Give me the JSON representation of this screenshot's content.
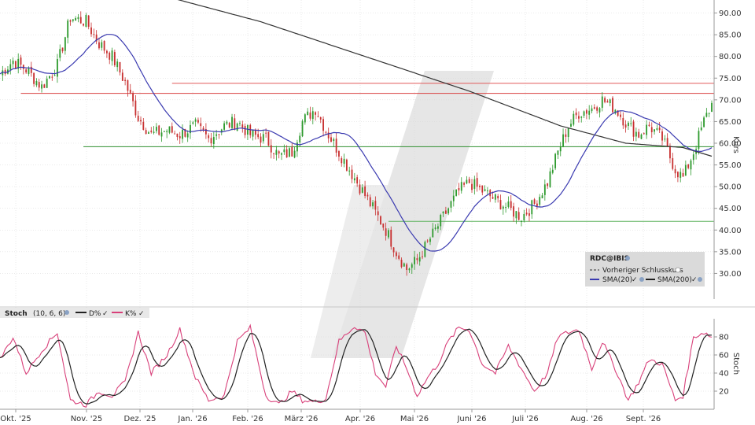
{
  "chart_data": {
    "type": "candlestick",
    "price_axis": {
      "label": "Kurs",
      "ticks": [
        "90.00",
        "85.00",
        "80.00",
        "75.00",
        "70.00",
        "65.00",
        "60.00",
        "55.00",
        "50.00",
        "45.00",
        "40.00",
        "35.00",
        "30.00"
      ],
      "ylim": [
        25,
        93
      ]
    },
    "months": [
      "Okt. '25",
      "Nov. '25",
      "Dez. '25",
      "Jan. '26",
      "Feb. '26",
      "März '26",
      "Apr. '26",
      "Mai '26",
      "Juni '26",
      "Juli '26",
      "Aug. '26",
      "Sept. '26"
    ],
    "num_bars": 250,
    "close_path": [
      [
        0,
        76
      ],
      [
        5,
        79
      ],
      [
        10,
        77
      ],
      [
        16,
        73
      ],
      [
        22,
        78
      ],
      [
        27,
        89
      ],
      [
        33,
        88
      ],
      [
        38,
        83
      ],
      [
        43,
        80
      ],
      [
        48,
        74
      ],
      [
        53,
        66
      ],
      [
        58,
        62
      ],
      [
        64,
        63
      ],
      [
        69,
        62
      ],
      [
        75,
        64
      ],
      [
        80,
        61
      ],
      [
        86,
        64
      ],
      [
        91,
        65
      ],
      [
        96,
        62
      ],
      [
        102,
        61
      ],
      [
        107,
        57
      ],
      [
        112,
        58
      ],
      [
        116,
        65
      ],
      [
        121,
        68
      ],
      [
        125,
        63
      ],
      [
        130,
        58
      ],
      [
        136,
        52
      ],
      [
        140,
        48
      ],
      [
        144,
        44
      ],
      [
        148,
        40
      ],
      [
        152,
        35
      ],
      [
        156,
        31
      ],
      [
        160,
        33
      ],
      [
        164,
        37
      ],
      [
        168,
        41
      ],
      [
        172,
        45
      ],
      [
        176,
        49
      ],
      [
        180,
        51
      ],
      [
        185,
        49
      ],
      [
        190,
        47
      ],
      [
        195,
        45
      ],
      [
        200,
        43
      ],
      [
        205,
        46
      ],
      [
        210,
        51
      ],
      [
        214,
        58
      ],
      [
        218,
        64
      ],
      [
        222,
        67
      ],
      [
        227,
        68
      ],
      [
        231,
        70
      ],
      [
        236,
        68
      ],
      [
        241,
        64
      ],
      [
        245,
        62
      ],
      [
        249,
        64
      ],
      [
        254,
        61
      ],
      [
        259,
        54
      ],
      [
        262,
        52
      ],
      [
        266,
        58
      ],
      [
        270,
        65
      ],
      [
        273,
        69
      ]
    ],
    "horizontal_levels": [
      {
        "value": 73.8,
        "color": "#e05a5a",
        "from_bar": 66
      },
      {
        "value": 71.5,
        "color": "#d84040",
        "from_bar": 8
      },
      {
        "value": 59.2,
        "color": "#2f8f2f",
        "from_bar": 32
      },
      {
        "value": 42.0,
        "color": "#5fb25f",
        "from_bar": 149
      }
    ],
    "legend": {
      "symbol": "RDC@IBIS",
      "prev_close": "Vorheriger Schlusskurs",
      "sma20": "SMA(20)",
      "sma200": "SMA(200)"
    },
    "stoch": {
      "title": "Stoch",
      "params": "(10, 6, 6)",
      "d_label": "D%",
      "k_label": "K%",
      "axis_label": "Stoch",
      "ticks": [
        "80",
        "60",
        "40",
        "20"
      ],
      "ylim": [
        0,
        100
      ],
      "k_anchors": [
        [
          0,
          55
        ],
        [
          5,
          80
        ],
        [
          10,
          40
        ],
        [
          16,
          65
        ],
        [
          22,
          85
        ],
        [
          27,
          10
        ],
        [
          33,
          5
        ],
        [
          38,
          20
        ],
        [
          43,
          15
        ],
        [
          48,
          30
        ],
        [
          53,
          85
        ],
        [
          58,
          40
        ],
        [
          64,
          60
        ],
        [
          69,
          88
        ],
        [
          75,
          35
        ],
        [
          80,
          10
        ],
        [
          86,
          15
        ],
        [
          91,
          75
        ],
        [
          96,
          90
        ],
        [
          102,
          15
        ],
        [
          107,
          5
        ],
        [
          112,
          20
        ],
        [
          116,
          10
        ],
        [
          121,
          8
        ],
        [
          125,
          12
        ],
        [
          130,
          75
        ],
        [
          136,
          92
        ],
        [
          140,
          85
        ],
        [
          144,
          40
        ],
        [
          148,
          25
        ],
        [
          152,
          70
        ],
        [
          156,
          45
        ],
        [
          160,
          15
        ],
        [
          164,
          35
        ],
        [
          168,
          50
        ],
        [
          172,
          75
        ],
        [
          176,
          90
        ],
        [
          180,
          88
        ],
        [
          185,
          50
        ],
        [
          190,
          40
        ],
        [
          195,
          70
        ],
        [
          200,
          45
        ],
        [
          205,
          20
        ],
        [
          210,
          40
        ],
        [
          214,
          80
        ],
        [
          218,
          85
        ],
        [
          222,
          88
        ],
        [
          227,
          45
        ],
        [
          231,
          75
        ],
        [
          236,
          45
        ],
        [
          241,
          10
        ],
        [
          245,
          30
        ],
        [
          249,
          55
        ],
        [
          254,
          50
        ],
        [
          259,
          10
        ],
        [
          262,
          15
        ],
        [
          266,
          80
        ],
        [
          270,
          85
        ],
        [
          273,
          80
        ]
      ]
    },
    "colors": {
      "up": "#2e9a2e",
      "down": "#c83030",
      "sma20": "#3a3ab0",
      "sma200": "#333333",
      "d_line": "#222222",
      "k_line": "#d8407a",
      "grid": "#d6d6d6",
      "watermark": "#dcdcdc"
    }
  }
}
